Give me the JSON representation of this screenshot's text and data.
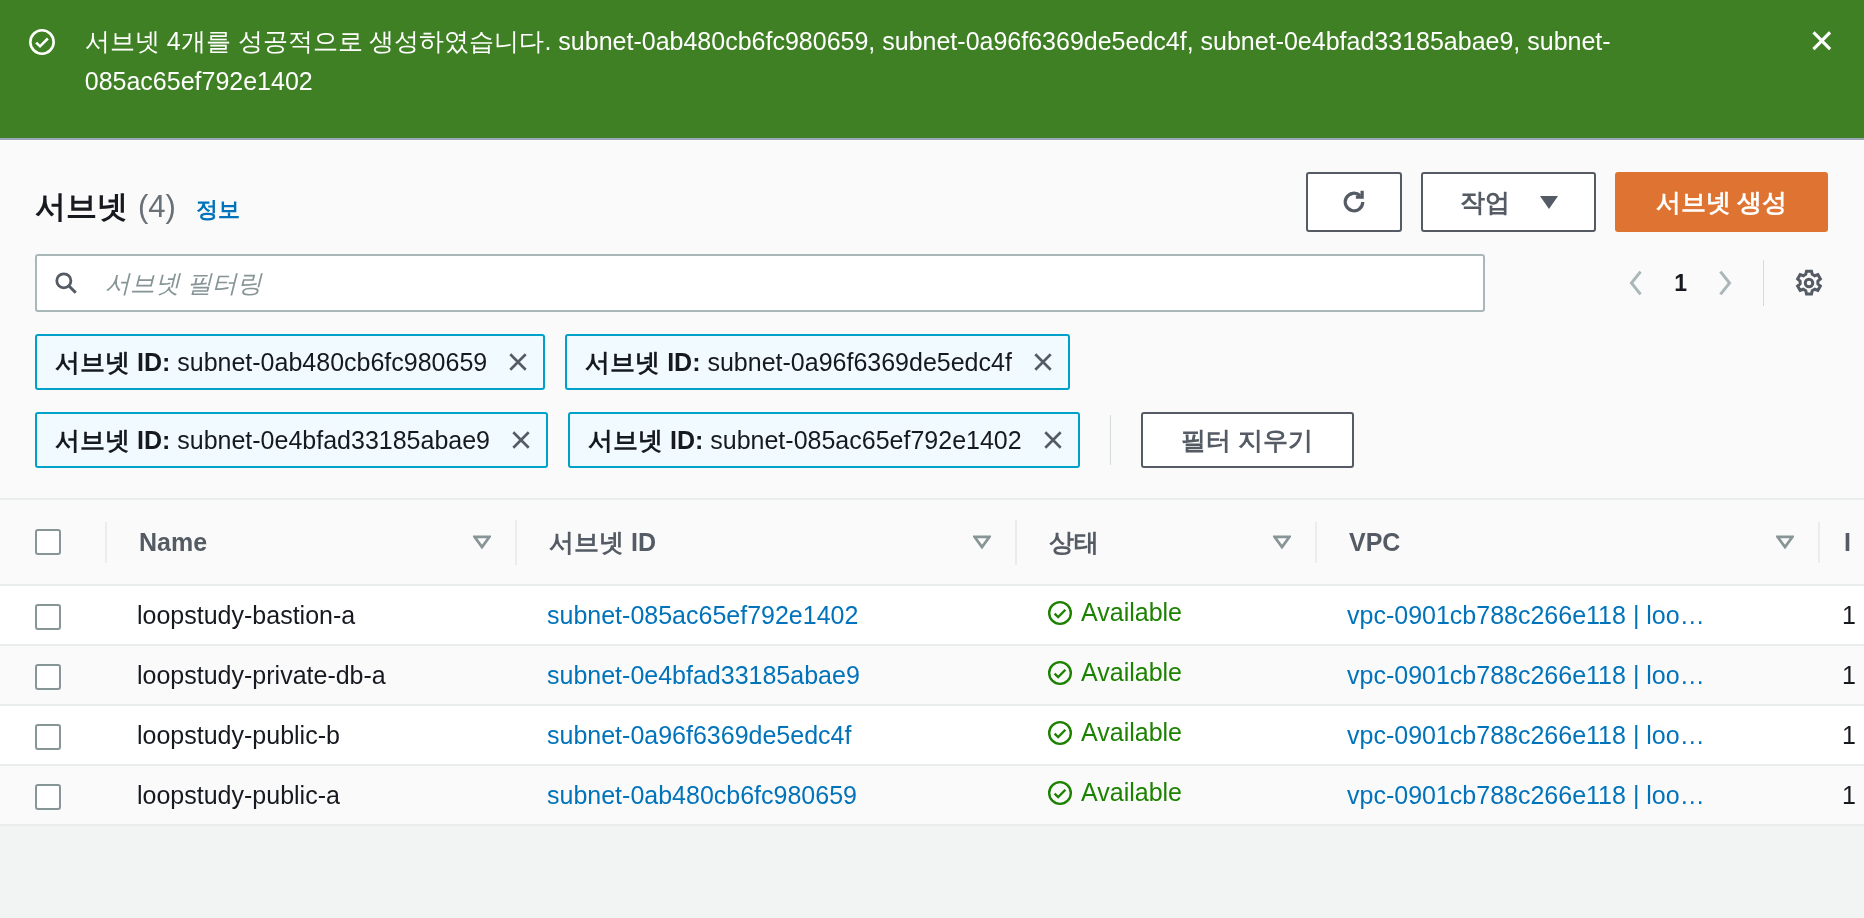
{
  "flash": {
    "kind": "success",
    "message": "서브넷 4개를 성공적으로 생성하였습니다. subnet-0ab480cb6fc980659, subnet-0a96f6369de5edc4f, subnet-0e4bfad33185abae9, subnet-085ac65ef792e1402",
    "dismiss_icon": "×"
  },
  "header": {
    "title": "서브넷",
    "count": "(4)",
    "info_link": "정보",
    "actions_button": "작업",
    "create_button": "서브넷 생성"
  },
  "filter": {
    "placeholder": "서브넷 필터링"
  },
  "pagination": {
    "prev_disabled": true,
    "page": "1",
    "next_disabled": true
  },
  "tokens": [
    {
      "key": "서브넷 ID:",
      "value": "subnet-0ab480cb6fc980659"
    },
    {
      "key": "서브넷 ID:",
      "value": "subnet-0a96f6369de5edc4f"
    },
    {
      "key": "서브넷 ID:",
      "value": "subnet-0e4bfad33185abae9"
    },
    {
      "key": "서브넷 ID:",
      "value": "subnet-085ac65ef792e1402"
    }
  ],
  "clear_filters_button": "필터 지우기",
  "table": {
    "header_checked": false,
    "columns": [
      "Name",
      "서브넷 ID",
      "상태",
      "VPC",
      "I"
    ],
    "rows": [
      {
        "checked": false,
        "name": "loopstudy-bastion-a",
        "subnet_id": "subnet-085ac65ef792e1402",
        "status": {
          "kind": "success",
          "text": "Available"
        },
        "vpc": "vpc-0901cb788c266e118 | loo…",
        "column_5": "1"
      },
      {
        "checked": false,
        "name": "loopstudy-private-db-a",
        "subnet_id": "subnet-0e4bfad33185abae9",
        "status": {
          "kind": "success",
          "text": "Available"
        },
        "vpc": "vpc-0901cb788c266e118 | loo…",
        "column_5": "1"
      },
      {
        "checked": false,
        "name": "loopstudy-public-b",
        "subnet_id": "subnet-0a96f6369de5edc4f",
        "status": {
          "kind": "success",
          "text": "Available"
        },
        "vpc": "vpc-0901cb788c266e118 | loo…",
        "column_5": "1"
      },
      {
        "checked": false,
        "name": "loopstudy-public-a",
        "subnet_id": "subnet-0ab480cb6fc980659",
        "status": {
          "kind": "success",
          "text": "Available"
        },
        "vpc": "vpc-0901cb788c266e118 | loo…",
        "column_5": "1"
      }
    ]
  }
}
